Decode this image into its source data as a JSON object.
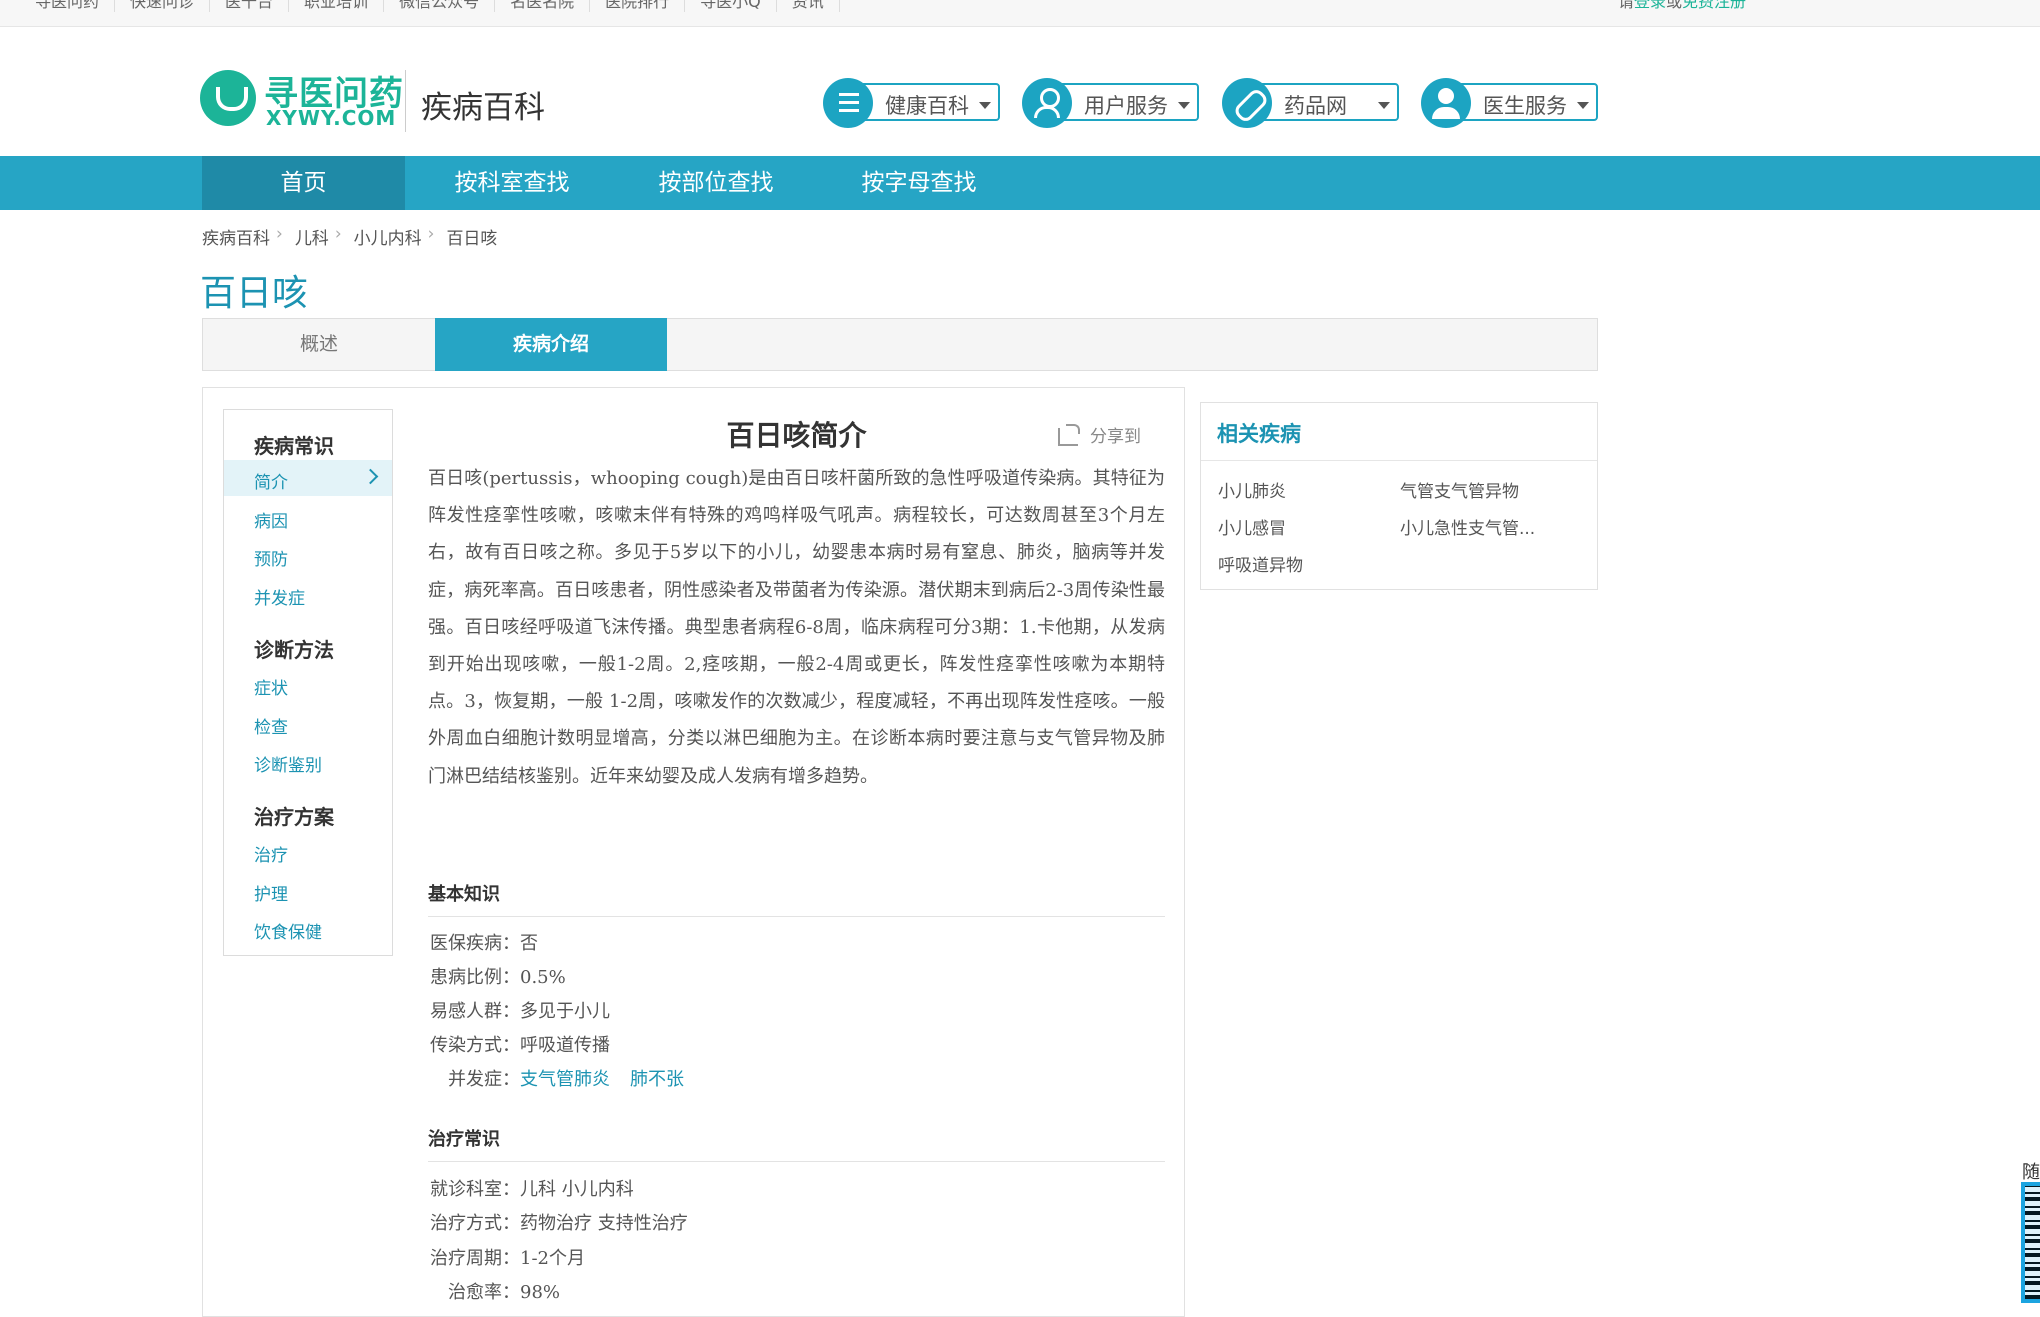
{
  "topbar": {
    "links": [
      "寻医问药",
      "快速问诊",
      "医千台",
      "职业培训",
      "微信公众号",
      "名医名院",
      "医院排行",
      "寻医小Q",
      "资讯"
    ],
    "login_prefix": "请",
    "login": "登录",
    "login_or": "或",
    "register": "免费注册"
  },
  "header": {
    "logo_cn": "寻医问药",
    "logo_en": "XYWY.COM",
    "site_name": "疾病百科",
    "buttons": [
      {
        "label": "健康百科",
        "icon": "list-icon"
      },
      {
        "label": "用户服务",
        "icon": "user-icon"
      },
      {
        "label": "药品网",
        "icon": "pill-icon"
      },
      {
        "label": "医生服务",
        "icon": "doctor-icon"
      }
    ]
  },
  "nav": [
    "首页",
    "按科室查找",
    "按部位查找",
    "按字母查找"
  ],
  "breadcrumb": [
    "疾病百科",
    "儿科",
    "小儿内科",
    "百日咳"
  ],
  "page_title": "百日咳",
  "tabs": [
    "概述",
    "疾病介绍"
  ],
  "sidebar": {
    "groups": [
      {
        "title": "疾病常识",
        "items": [
          "简介",
          "病因",
          "预防",
          "并发症"
        ]
      },
      {
        "title": "诊断方法",
        "items": [
          "症状",
          "检查",
          "诊断鉴别"
        ]
      },
      {
        "title": "治疗方案",
        "items": [
          "治疗",
          "护理",
          "饮食保健"
        ]
      }
    ]
  },
  "article": {
    "title": "百日咳简介",
    "share": "分享到",
    "intro": "百日咳(pertussis，whooping cough)是由百日咳杆菌所致的急性呼吸道传染病。其特征为阵发性痉挛性咳嗽，咳嗽末伴有特殊的鸡鸣样吸气吼声。病程较长，可达数周甚至3个月左右，故有百日咳之称。多见于5岁以下的小儿，幼婴患本病时易有窒息、肺炎，脑病等并发症，病死率高。百日咳患者，阴性感染者及带菌者为传染源。潜伏期末到病后2-3周传染性最强。百日咳经呼吸道飞沫传播。典型患者病程6-8周，临床病程可分3期：1.卡他期，从发病到开始出现咳嗽，一般1-2周。2,痉咳期，一般2-4周或更长，阵发性痉挛性咳嗽为本期特点。3，恢复期，一般 1-2周，咳嗽发作的次数减少，程度减轻，不再出现阵发性痉咳。一般外周血白细胞计数明显增高，分类以淋巴细胞为主。在诊断本病时要注意与支气管异物及肺门淋巴结结核鉴别。近年来幼婴及成人发病有增多趋势。",
    "basic": {
      "heading": "基本知识",
      "rows": [
        {
          "k": "医保疾病：",
          "v": "否"
        },
        {
          "k": "患病比例：",
          "v": "0.5%"
        },
        {
          "k": "易感人群：",
          "v": "多见于小儿"
        },
        {
          "k": "传染方式：",
          "v": "呼吸道传播"
        }
      ],
      "complication_label": "并发症：",
      "complications": [
        "支气管肺炎",
        "肺不张"
      ]
    },
    "treatment": {
      "heading": "治疗常识",
      "rows": [
        {
          "k": "就诊科室：",
          "v": "儿科 小儿内科"
        },
        {
          "k": "治疗方式：",
          "v": "药物治疗 支持性治疗"
        },
        {
          "k": "治疗周期：",
          "v": "1-2个月"
        },
        {
          "k": "治愈率：",
          "v": "98%"
        }
      ]
    }
  },
  "related": {
    "title": "相关疾病",
    "items": [
      "小儿肺炎",
      "气管支气管异物",
      "小儿感冒",
      "小儿急性支气管...",
      "呼吸道异物"
    ]
  },
  "floating": {
    "label": "随"
  },
  "colors": {
    "brand_green": "#1cb498",
    "accent_blue": "#26a5c5",
    "link_blue": "#1c93b2"
  }
}
